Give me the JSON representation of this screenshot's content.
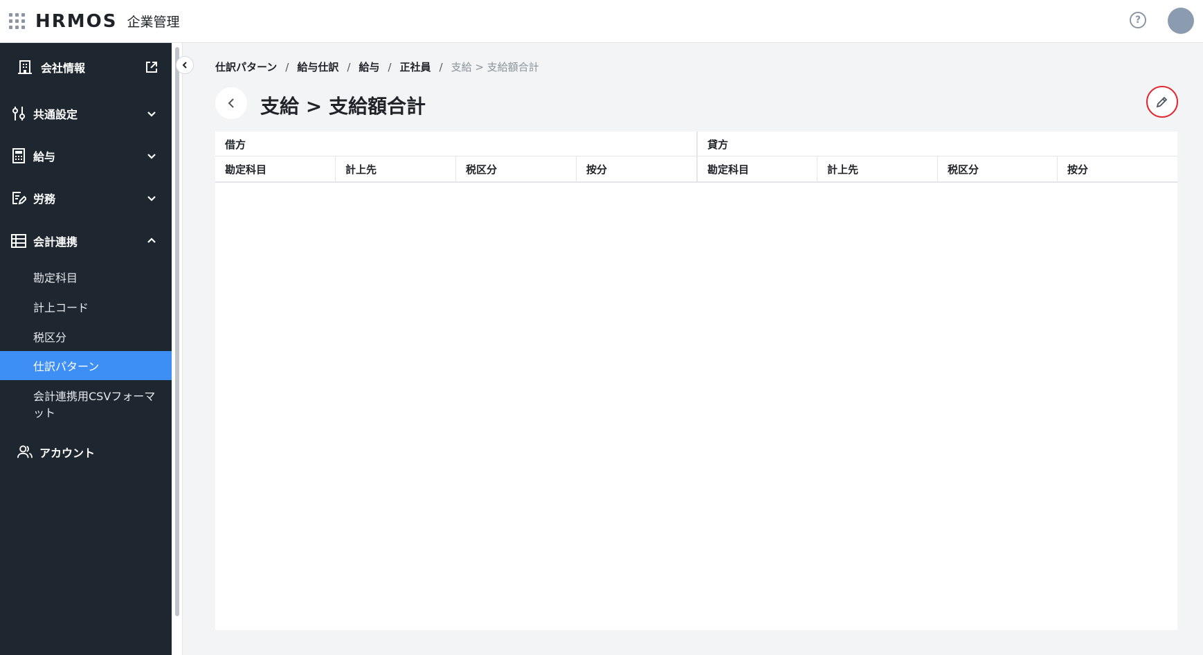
{
  "header": {
    "logo": "HRMOS",
    "logo_sub": "企業管理",
    "help_glyph": "?"
  },
  "sidebar": {
    "items": [
      {
        "label": "会社情報",
        "icon": "building-icon"
      },
      {
        "label": "共通設定",
        "icon": "sliders-icon"
      },
      {
        "label": "給与",
        "icon": "calculator-icon"
      },
      {
        "label": "労務",
        "icon": "document-edit-icon"
      },
      {
        "label": "会計連携",
        "icon": "table-icon"
      }
    ],
    "sub_items": [
      "勘定科目",
      "計上コード",
      "税区分",
      "仕訳パターン",
      "会計連携用CSVフォーマット"
    ],
    "active_sub": "仕訳パターン",
    "account_label": "アカウント"
  },
  "breadcrumb": {
    "items": [
      "仕訳パターン",
      "給与仕訳",
      "給与",
      "正社員"
    ],
    "separator": "/",
    "current": "支給 > 支給額合計"
  },
  "page": {
    "title": "支給 > 支給額合計"
  },
  "table": {
    "groups": [
      "借方",
      "貸方"
    ],
    "debit_columns": [
      "勘定科目",
      "計上先",
      "税区分",
      "按分"
    ],
    "credit_columns": [
      "勘定科目",
      "計上先",
      "税区分",
      "按分"
    ]
  },
  "colors": {
    "sidebar_bg": "#1e2730",
    "active_bg": "#3d8ef5",
    "edit_ring": "#e2252e"
  }
}
